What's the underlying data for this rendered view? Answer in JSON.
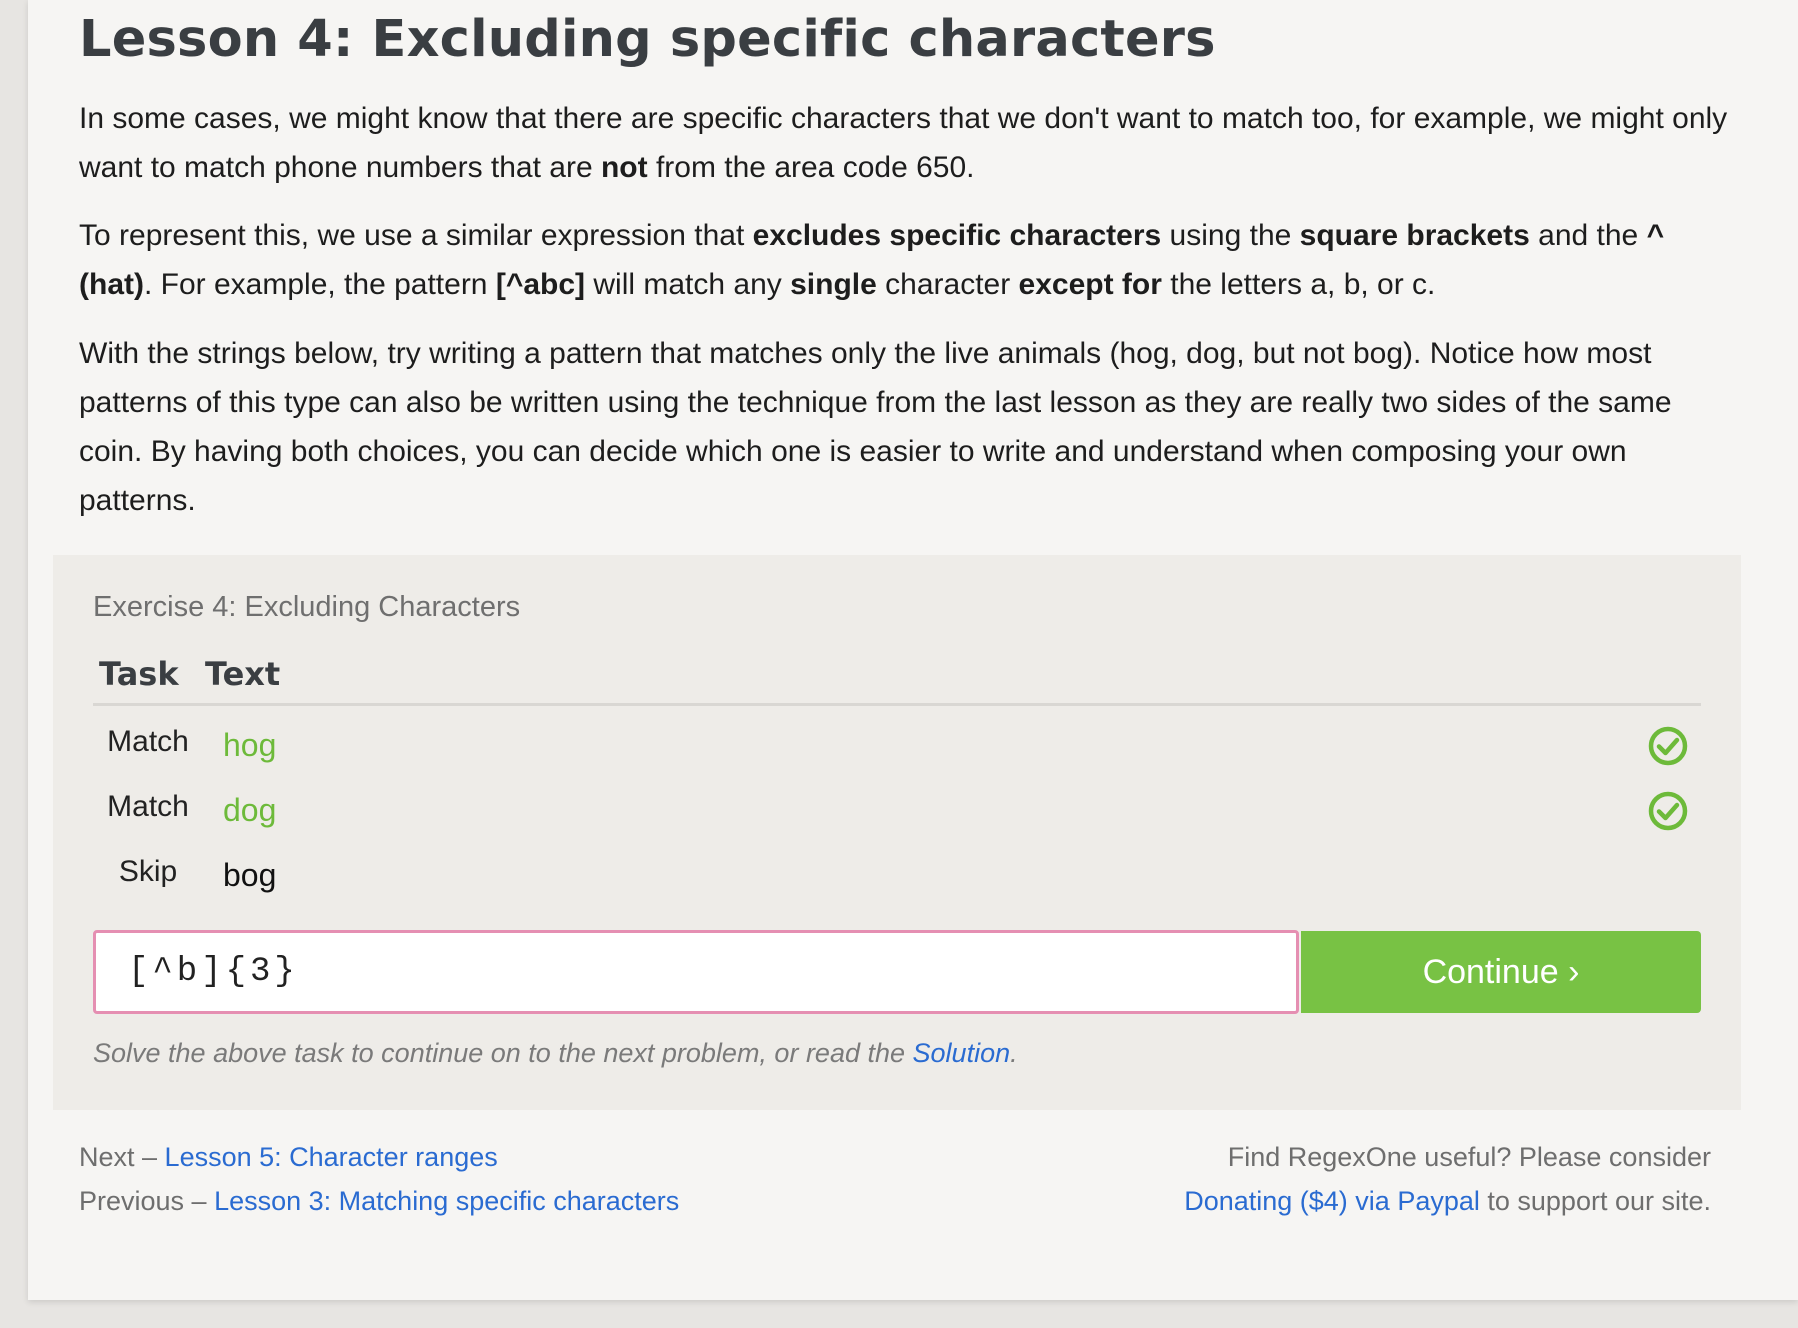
{
  "lesson": {
    "title": "Lesson 4: Excluding specific characters",
    "p1": [
      {
        "t": "In some cases, we might know that there are specific characters that we don't want to match too, for example, we might only want to match phone numbers that are "
      },
      {
        "t": "not",
        "b": true
      },
      {
        "t": " from the area code 650."
      }
    ],
    "p2": [
      {
        "t": "To represent this, we use a similar expression that "
      },
      {
        "t": "excludes specific characters",
        "b": true
      },
      {
        "t": " using the "
      },
      {
        "t": "square brackets",
        "b": true
      },
      {
        "t": " and the "
      },
      {
        "t": "^ (hat)",
        "b": true
      },
      {
        "t": ". For example, the pattern "
      },
      {
        "t": "[^abc]",
        "b": true
      },
      {
        "t": " will match any "
      },
      {
        "t": "single",
        "b": true
      },
      {
        "t": " character "
      },
      {
        "t": "except for",
        "b": true
      },
      {
        "t": " the letters a, b, or c."
      }
    ],
    "p3": [
      {
        "t": "With the strings below, try writing a pattern that matches only the live animals (hog, dog, but not bog). Notice how most patterns of this type can also be written using the technique from the last lesson as they are really two sides of the same coin. By having both choices, you can decide which one is easier to write and understand when composing your own patterns."
      }
    ]
  },
  "exercise": {
    "title": "Exercise 4: Excluding Characters",
    "columns": {
      "task": "Task",
      "text": "Text"
    },
    "rows": [
      {
        "task": "Match",
        "text": "hog",
        "status": "matched"
      },
      {
        "task": "Match",
        "text": "dog",
        "status": "matched"
      },
      {
        "task": "Skip",
        "text": "bog",
        "status": "skipped"
      }
    ],
    "input_value": "[^b]{3}",
    "continue_label": "Continue ›",
    "hint_prefix": "Solve the above task to continue on to the next problem, or read the ",
    "hint_link": "Solution",
    "hint_suffix": "."
  },
  "footer": {
    "next_prefix": "Next – ",
    "next_link": "Lesson 5: Character ranges",
    "prev_prefix": "Previous – ",
    "prev_link": "Lesson 3: Matching specific characters",
    "donate_line1": "Find RegexOne useful? Please consider",
    "donate_link": "Donating ($4) via Paypal",
    "donate_suffix": " to support our site."
  },
  "colors": {
    "accent_green": "#78c244",
    "match_green": "#6dba3a",
    "link_blue": "#2a6bd1",
    "input_border_pink": "#e58fb2"
  }
}
